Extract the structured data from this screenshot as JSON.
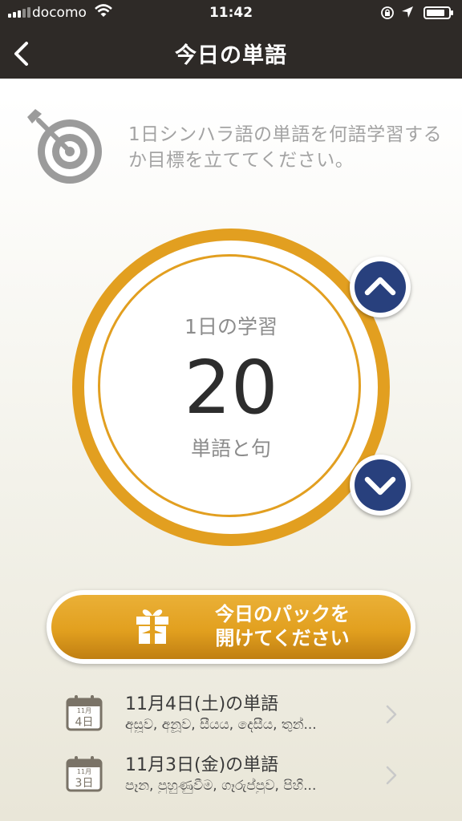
{
  "status_bar": {
    "carrier": "docomo",
    "time": "11:42"
  },
  "nav": {
    "title": "今日の単語"
  },
  "goal": {
    "text": "1日シンハラ語の単語を何語学習するか目標を立ててください。"
  },
  "daily": {
    "label": "1日の学習",
    "count": "20",
    "unit": "単語と句"
  },
  "pack_button": {
    "line1": "今日のパックを",
    "line2": "開けてください"
  },
  "history": [
    {
      "month": "11月",
      "day": "4日",
      "title": "11月4日(土)の単語",
      "words": "අසූව, අනූව, සීයය, දෙසීය, තුන්..."
    },
    {
      "month": "11月",
      "day": "3日",
      "title": "11月3日(金)の単語",
      "words": "පෑන, පුහුණුවීම, ගෑරුප්පුව, පිහි..."
    }
  ],
  "colors": {
    "header": "#2e2a27",
    "accent": "#e29f20",
    "arrow": "#28407d"
  },
  "icons": [
    "signal-icon",
    "wifi-icon",
    "lock-rotation-icon",
    "location-arrow-icon",
    "battery-icon",
    "back-chevron-icon",
    "target-icon",
    "chevron-up-icon",
    "chevron-down-icon",
    "gift-icon",
    "calendar-icon",
    "chevron-right-icon"
  ]
}
